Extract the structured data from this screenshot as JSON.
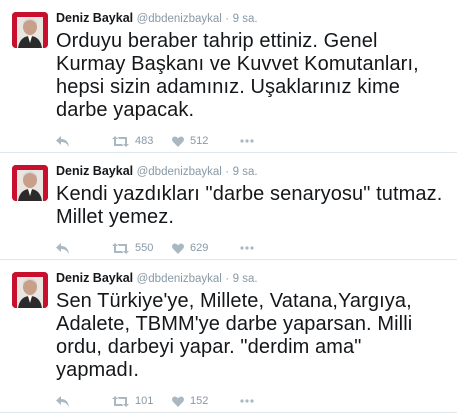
{
  "tweets": [
    {
      "fullname": "Deniz Baykal",
      "username": "@dbdenizbaykal",
      "separator": "·",
      "time": "9 sa.",
      "text": "Orduyu beraber tahrip ettiniz. Genel Kurmay Başkanı ve Kuvvet Komutanları, hepsi sizin adamınız. Uşaklarınız kime darbe yapacak.",
      "retweets": "483",
      "likes": "512"
    },
    {
      "fullname": "Deniz Baykal",
      "username": "@dbdenizbaykal",
      "separator": "·",
      "time": "9 sa.",
      "text": "Kendi yazdıkları \"darbe senaryosu\" tutmaz. Millet yemez.",
      "retweets": "550",
      "likes": "629"
    },
    {
      "fullname": "Deniz Baykal",
      "username": "@dbdenizbaykal",
      "separator": "·",
      "time": "9 sa.",
      "text": "Sen Türkiye'ye, Millete, Vatana,Yargıya, Adalete, TBMM'ye darbe yaparsan. Milli ordu, darbeyi yapar. \"derdim ama\" yapmadı.",
      "retweets": "101",
      "likes": "152"
    }
  ],
  "icons": {
    "reply": "reply-icon",
    "retweet": "retweet-icon",
    "like": "heart-icon",
    "more": "more-dots-icon"
  },
  "colors": {
    "text": "#14171a",
    "muted": "#8899a6",
    "icon": "#aab8c2",
    "divider": "#e1e8ed"
  }
}
